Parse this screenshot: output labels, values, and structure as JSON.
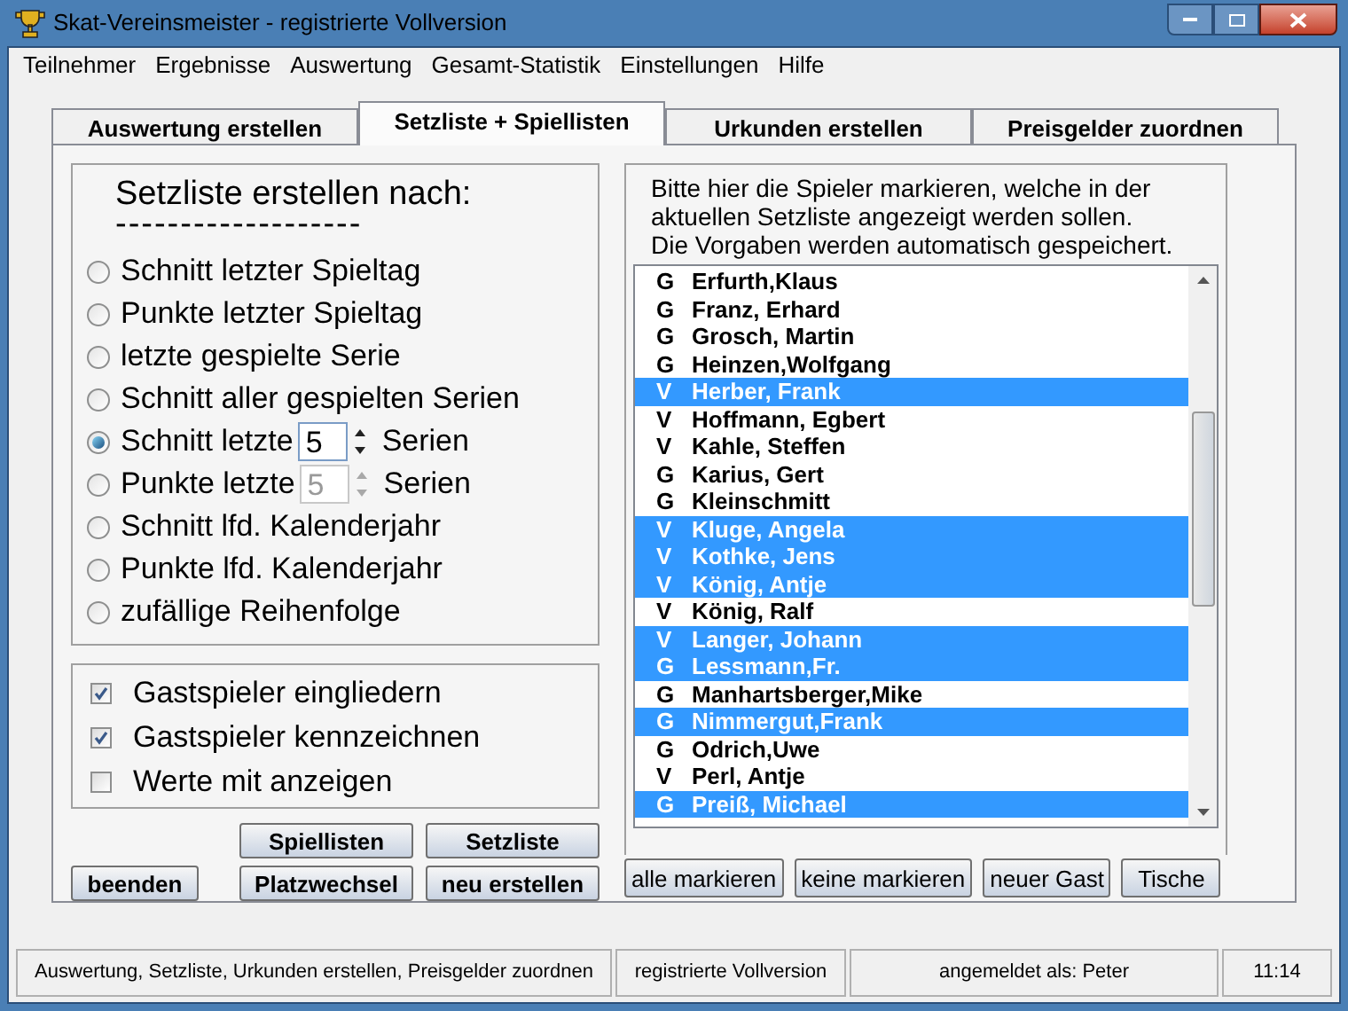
{
  "window": {
    "title": "Skat-Vereinsmeister - registrierte Vollversion"
  },
  "menu": [
    "Teilnehmer",
    "Ergebnisse",
    "Auswertung",
    "Gesamt-Statistik",
    "Einstellungen",
    "Hilfe"
  ],
  "tabs": [
    {
      "label": "Auswertung erstellen",
      "selected": false
    },
    {
      "label": "Setzliste + Spiellisten",
      "selected": true
    },
    {
      "label": "Urkunden erstellen",
      "selected": false
    },
    {
      "label": "Preisgelder zuordnen",
      "selected": false
    }
  ],
  "setzliste": {
    "heading": "Setzliste erstellen nach:",
    "underline": "-------------------",
    "options": [
      {
        "kind": "plain",
        "label": "Schnitt letzter Spieltag",
        "selected": false
      },
      {
        "kind": "plain",
        "label": "Punkte letzter Spieltag",
        "selected": false
      },
      {
        "kind": "plain",
        "label": "letzte gespielte Serie",
        "selected": false
      },
      {
        "kind": "plain",
        "label": "Schnitt aller gespielten Serien",
        "selected": false
      },
      {
        "kind": "spinner",
        "label": "Schnitt letzte",
        "value": "5",
        "suffix": "Serien",
        "disabled": false,
        "selected": true
      },
      {
        "kind": "spinner",
        "label": "Punkte letzte",
        "value": "5",
        "suffix": "Serien",
        "disabled": true,
        "selected": false
      },
      {
        "kind": "plain",
        "label": "Schnitt lfd. Kalenderjahr",
        "selected": false
      },
      {
        "kind": "plain",
        "label": "Punkte lfd. Kalenderjahr",
        "selected": false
      },
      {
        "kind": "plain",
        "label": "zufällige Reihenfolge",
        "selected": false
      }
    ]
  },
  "checkboxes": [
    {
      "label": "Gastspieler eingliedern",
      "checked": true
    },
    {
      "label": "Gastspieler kennzeichnen",
      "checked": true
    },
    {
      "label": "Werte mit anzeigen",
      "checked": false
    }
  ],
  "left_buttons": {
    "exit": "beenden",
    "top": [
      "Spiellisten",
      "Setzliste"
    ],
    "bottom": [
      "Platzwechsel",
      "neu erstellen"
    ]
  },
  "instructions": [
    "Bitte hier die Spieler markieren, welche in der",
    "aktuellen Setzliste angezeigt werden sollen.",
    "Die Vorgaben werden automatisch gespeichert."
  ],
  "players": [
    {
      "type": "G",
      "name": "Erfurth,Klaus",
      "selected": false
    },
    {
      "type": "G",
      "name": "Franz, Erhard",
      "selected": false
    },
    {
      "type": "G",
      "name": "Grosch, Martin",
      "selected": false
    },
    {
      "type": "G",
      "name": "Heinzen,Wolfgang",
      "selected": false
    },
    {
      "type": "V",
      "name": "Herber, Frank",
      "selected": true
    },
    {
      "type": "V",
      "name": "Hoffmann, Egbert",
      "selected": false
    },
    {
      "type": "V",
      "name": "Kahle, Steffen",
      "selected": false
    },
    {
      "type": "G",
      "name": "Karius, Gert",
      "selected": false
    },
    {
      "type": "G",
      "name": "Kleinschmitt",
      "selected": false
    },
    {
      "type": "V",
      "name": "Kluge, Angela",
      "selected": true
    },
    {
      "type": "V",
      "name": "Kothke, Jens",
      "selected": true
    },
    {
      "type": "V",
      "name": "König, Antje",
      "selected": true
    },
    {
      "type": "V",
      "name": "König, Ralf",
      "selected": false
    },
    {
      "type": "V",
      "name": "Langer, Johann",
      "selected": true
    },
    {
      "type": "G",
      "name": "Lessmann,Fr.",
      "selected": true
    },
    {
      "type": "G",
      "name": "Manhartsberger,Mike",
      "selected": false
    },
    {
      "type": "G",
      "name": "Nimmergut,Frank",
      "selected": true
    },
    {
      "type": "G",
      "name": "Odrich,Uwe",
      "selected": false
    },
    {
      "type": "V",
      "name": "Perl, Antje",
      "selected": false
    },
    {
      "type": "G",
      "name": "Preiß, Michael",
      "selected": true
    }
  ],
  "right_buttons": [
    "alle markieren",
    "keine markieren",
    "neuer Gast",
    "Tische"
  ],
  "status_bar": [
    "Auswertung, Setzliste, Urkunden erstellen, Preisgelder zuordnen",
    "registrierte Vollversion",
    "angemeldet als: Peter",
    "11:14"
  ]
}
